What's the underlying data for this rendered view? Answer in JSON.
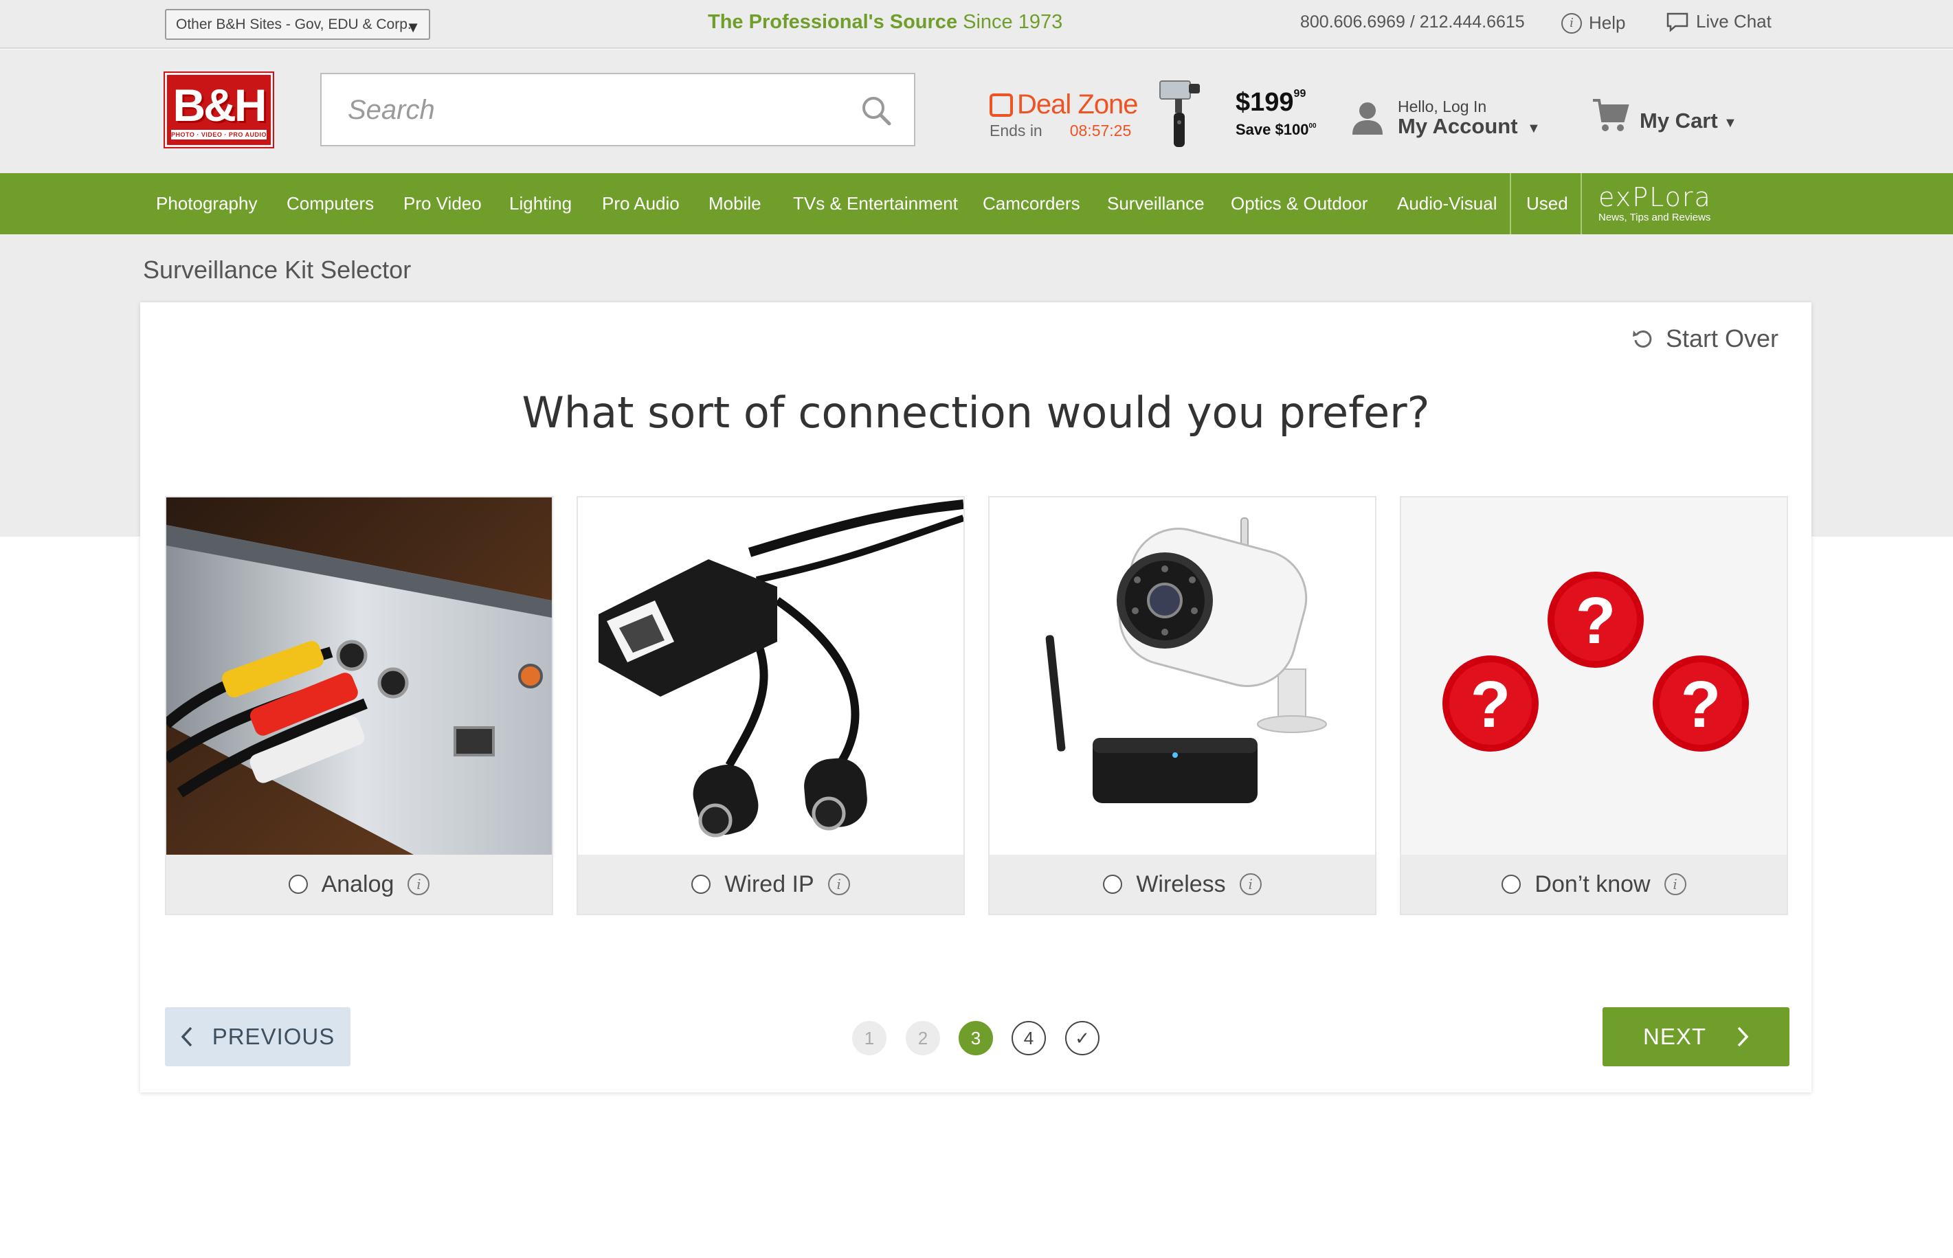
{
  "topbar": {
    "other_sites": "Other B&H Sites - Gov, EDU & Corp.",
    "tagline_bold": "The Professional's Source",
    "tagline_rest": " Since 1973",
    "phones": "800.606.6969 / 212.444.6615",
    "help": "Help",
    "live_chat": "Live Chat"
  },
  "header": {
    "logo_text": "B&H",
    "logo_strip": "PHOTO · VIDEO · PRO AUDIO",
    "search_placeholder": "Search",
    "deal_zone": {
      "title": "Deal Zone",
      "ends_label": "Ends in",
      "timer": "08:57:25",
      "price": "$199",
      "price_cents": "99",
      "save": "Save $100",
      "save_cents": "00"
    },
    "account": {
      "greeting": "Hello, Log In",
      "label": "My Account"
    },
    "cart": {
      "label": "My Cart"
    }
  },
  "nav": {
    "items": [
      "Photography",
      "Computers",
      "Pro Video",
      "Lighting",
      "Pro Audio",
      "Mobile",
      "TVs & Entertainment",
      "Camcorders",
      "Surveillance",
      "Optics & Outdoor",
      "Audio-Visual",
      "Used"
    ],
    "explora": {
      "name": "exPLora",
      "tagline": "News, Tips and Reviews"
    }
  },
  "page": {
    "title": "Surveillance Kit Selector",
    "start_over": "Start Over",
    "question": "What sort of connection would you prefer?",
    "options": [
      {
        "label": "Analog",
        "image": "rca-cables-photo"
      },
      {
        "label": "Wired IP",
        "image": "ethernet-adapter-photo"
      },
      {
        "label": "Wireless",
        "image": "wireless-camera-photo"
      },
      {
        "label": "Don’t know",
        "image": "question-marks-graphic"
      }
    ],
    "previous": "PREVIOUS",
    "next": "NEXT",
    "steps": [
      {
        "label": "1",
        "state": "done"
      },
      {
        "label": "2",
        "state": "done"
      },
      {
        "label": "3",
        "state": "active"
      },
      {
        "label": "4",
        "state": "todo"
      },
      {
        "label": "✓",
        "state": "todo"
      }
    ]
  },
  "colors": {
    "brand_green": "#6f9e2a",
    "brand_red": "#c91515",
    "deal_orange": "#ef5323"
  }
}
